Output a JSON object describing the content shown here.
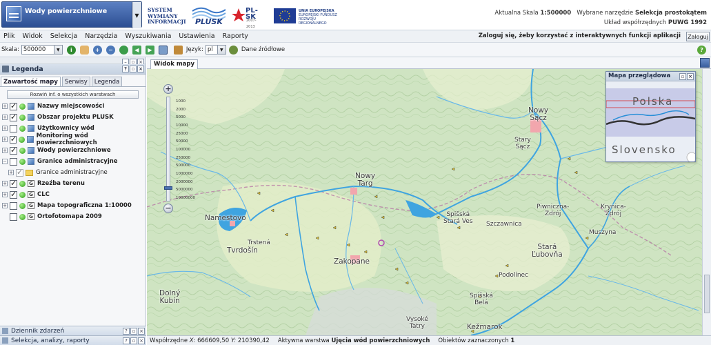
{
  "header": {
    "theme": "Wody powierzchniowe",
    "logo_swi": [
      "SYSTEM",
      "WYMIANY",
      "INFORMACJI"
    ],
    "logo_plusk": "PLUSK",
    "logo_plsk": "PL-SK",
    "logo_plsk_years": "2007-2013",
    "logo_eu": [
      "UNIA EUROPEJSKA",
      "EUROPEJSKI FUNDUSZ",
      "ROZWOJU REGIONALNEGO"
    ],
    "scale_label": "Aktualna Skala",
    "scale_value": "1:500000",
    "tool_label": "Wybrane narzędzie",
    "tool_value": "Selekcja prostokątem",
    "crs_label": "Układ współrzędnych",
    "crs_value": "PUWG 1992"
  },
  "menu": {
    "items": [
      "Plik",
      "Widok",
      "Selekcja",
      "Narzędzia",
      "Wyszukiwania",
      "Ustawienia",
      "Raporty"
    ],
    "login_message": "Zaloguj się, żeby korzystać z interaktywnych funkcji aplikacji",
    "login_button": "Zaloguj"
  },
  "toolbar": {
    "scale_label": "Skala:",
    "scale_value": "500000",
    "language_label": "Język:",
    "language_value": "pl",
    "data_sources": "Dane źródłowe",
    "help": "?"
  },
  "legend": {
    "title": "Legenda",
    "tabs": [
      "Zawartość mapy",
      "Serwisy",
      "Legenda"
    ],
    "expand_button": "Rozwiń inf. o wszystkich warstwach",
    "layers": [
      {
        "label": "Nazwy miejscowości",
        "checked": true
      },
      {
        "label": "Obszar projektu PLUSK",
        "checked": true
      },
      {
        "label": "Użytkownicy wód",
        "checked": false
      },
      {
        "label": "Monitoring wód powierzchniowych",
        "checked": true
      },
      {
        "label": "Wody powierzchniowe",
        "checked": true
      },
      {
        "label": "Granice administracyjne",
        "checked": false
      },
      {
        "label": "Granice administracyjne",
        "checked": true,
        "sub": true
      },
      {
        "label": "Rzeźba terenu",
        "checked": true
      },
      {
        "label": "CLC",
        "checked": true
      },
      {
        "label": "Mapa topograficzna 1:10000",
        "checked": false
      },
      {
        "label": "Ortofotomapa 2009",
        "checked": false
      }
    ]
  },
  "bottom_panels": [
    "Dziennik zdarzeń",
    "Selekcja, analizy, raporty"
  ],
  "map": {
    "tab": "Widok mapy",
    "zoom_labels": [
      "1000",
      "2000",
      "5000",
      "10000",
      "25000",
      "50000",
      "100000",
      "250000",
      "500000",
      "1000000",
      "2000000",
      "5000000",
      "10000000"
    ],
    "places": [
      {
        "name": "Nowy\nSącz",
        "big": true
      },
      {
        "name": "Stary\nSącz"
      },
      {
        "name": "Nowy\nTarg",
        "big": true
      },
      {
        "name": "Namestovo",
        "big": true
      },
      {
        "name": "Trstená"
      },
      {
        "name": "Tvrdošín",
        "big": true
      },
      {
        "name": "Zakopane",
        "big": true
      },
      {
        "name": "Spišská\nStará Ves"
      },
      {
        "name": "Szczawnica"
      },
      {
        "name": "Piwniczna-\nZdrój"
      },
      {
        "name": "Krynica-\nZdrój"
      },
      {
        "name": "Muszyna"
      },
      {
        "name": "Stará\nĽubovňa",
        "big": true
      },
      {
        "name": "Podolínec"
      },
      {
        "name": "Spišská\nBelá"
      },
      {
        "name": "Kežmarok",
        "big": true
      },
      {
        "name": "Vysoké\nTatry"
      },
      {
        "name": "Dolný\nKubín",
        "big": true
      }
    ]
  },
  "overview": {
    "title": "Mapa przeglądowa",
    "label_pl": "Polska",
    "label_sk": "Slovensko"
  },
  "status": {
    "coords_label": "Współrzędne",
    "x_label": "X:",
    "x_value": "666609,50",
    "y_label": "Y:",
    "y_value": "210390,42",
    "active_layer_label": "Aktywna warstwa",
    "active_layer_value": "Ujęcia wód powierzchniowych",
    "selected_label": "Obiektów zaznaczonych",
    "selected_value": "1"
  },
  "colors": {
    "water": "#3fa4e0",
    "accent": "#2c4f93"
  }
}
